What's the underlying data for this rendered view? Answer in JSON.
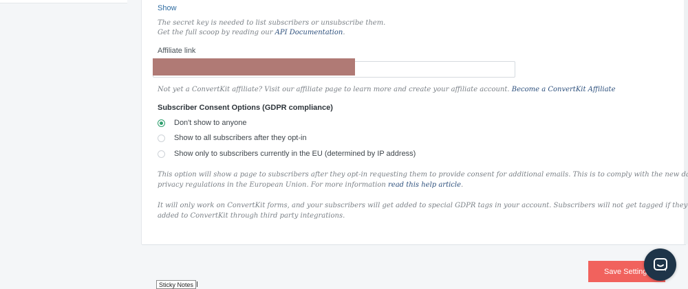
{
  "secret_key": {
    "show_label": "Show",
    "description_line1": "The secret key is needed to list subscribers or unsubscribe them.",
    "description_line2_prefix": "Get the full scoop by reading our ",
    "api_docs_link": "API Documentation",
    "description_line2_suffix": "."
  },
  "affiliate": {
    "label": "Affiliate link",
    "value": "",
    "note_prefix": "Not yet a ConvertKit affiliate? Visit our affiliate page to learn more and create your affiliate account. ",
    "become_affiliate_link": "Become a ConvertKit Affiliate"
  },
  "gdpr": {
    "heading": "Subscriber Consent Options (GDPR compliance)",
    "options": [
      {
        "label": "Don't show to anyone",
        "checked": true
      },
      {
        "label": "Show to all subscribers after they opt-in",
        "checked": false
      },
      {
        "label": "Show only to subscribers currently in the EU (determined by IP address)",
        "checked": false
      }
    ],
    "desc1_line1": "This option will show a page to subscribers after they opt-in requesting them to provide consent for additional emails. This is to comply with the new data",
    "desc1_line2_prefix": "privacy regulations in the European Union. For more information ",
    "help_article_link": "read this help article",
    "desc1_line2_suffix": ".",
    "desc2_line1": "It will only work on ConvertKit forms, and your subscribers will get added to special GDPR tags in your account. Subscribers will not get tagged if they are",
    "desc2_line2": "added to ConvertKit through third party integrations."
  },
  "footer": {
    "save_label": "Save Settings",
    "sticky_notes_label": "Sticky Notes"
  },
  "colors": {
    "accent_green": "#2e9f6e",
    "save_button": "#f1625d",
    "link_blue": "#2c6aa0",
    "chat_launcher": "#1e3448"
  },
  "icons": {
    "chat": "chat-bubble-icon"
  }
}
